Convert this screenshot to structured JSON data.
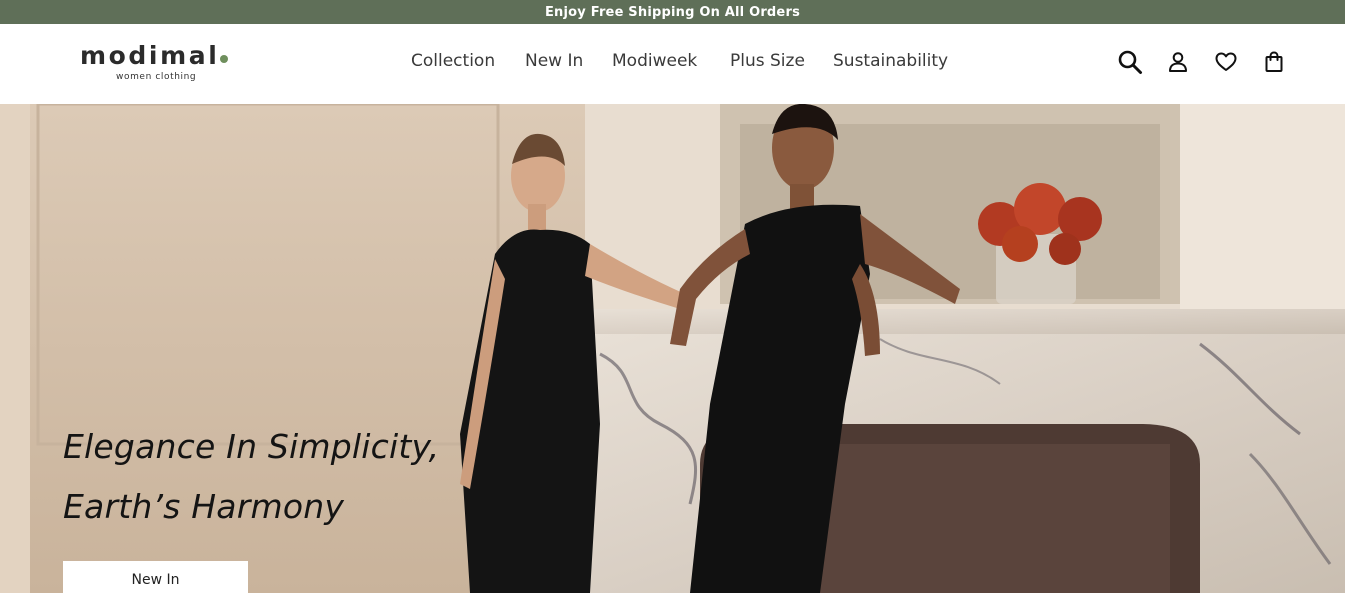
{
  "promo": {
    "text": "Enjoy Free Shipping On All Orders"
  },
  "header": {
    "logo": {
      "word": "modimal",
      "tagline": "women clothing"
    },
    "nav": [
      {
        "label": "Collection"
      },
      {
        "label": "New In"
      },
      {
        "label": "Modiweek"
      },
      {
        "label": "Plus Size"
      },
      {
        "label": "Sustainability"
      }
    ],
    "icons": [
      "search-icon",
      "user-icon",
      "heart-icon",
      "shopping-bag-icon"
    ]
  },
  "hero": {
    "headline_line1": "Elegance In Simplicity,",
    "headline_line2": "Earth’s Harmony",
    "cta_label": "New In"
  },
  "colors": {
    "promo_bg": "#5f6f58",
    "logo_dot": "#6f8f5d",
    "text": "#222222"
  }
}
